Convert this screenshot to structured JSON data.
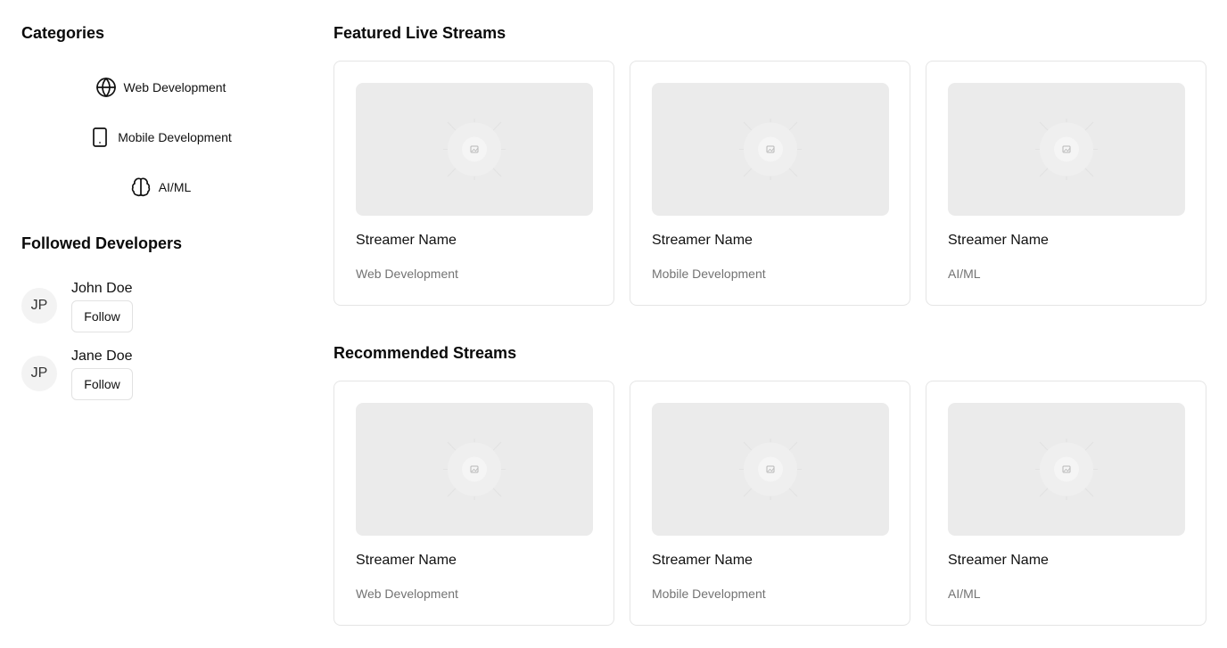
{
  "sidebar": {
    "categories_title": "Categories",
    "categories": [
      {
        "label": "Web Development",
        "icon": "globe-icon"
      },
      {
        "label": "Mobile Development",
        "icon": "smartphone-icon"
      },
      {
        "label": "AI/ML",
        "icon": "brain-icon"
      }
    ],
    "followed_title": "Followed Developers",
    "developers": [
      {
        "initials": "JP",
        "name": "John Doe",
        "button": "Follow"
      },
      {
        "initials": "JP",
        "name": "Jane Doe",
        "button": "Follow"
      }
    ]
  },
  "main": {
    "featured_title": "Featured Live Streams",
    "featured": [
      {
        "name": "Streamer Name",
        "category": "Web Development"
      },
      {
        "name": "Streamer Name",
        "category": "Mobile Development"
      },
      {
        "name": "Streamer Name",
        "category": "AI/ML"
      }
    ],
    "recommended_title": "Recommended Streams",
    "recommended": [
      {
        "name": "Streamer Name",
        "category": "Web Development"
      },
      {
        "name": "Streamer Name",
        "category": "Mobile Development"
      },
      {
        "name": "Streamer Name",
        "category": "AI/ML"
      }
    ]
  },
  "colors": {
    "thumbnail_bg": "#ebebeb",
    "muted_text": "#737373",
    "border": "#e5e5e5"
  }
}
